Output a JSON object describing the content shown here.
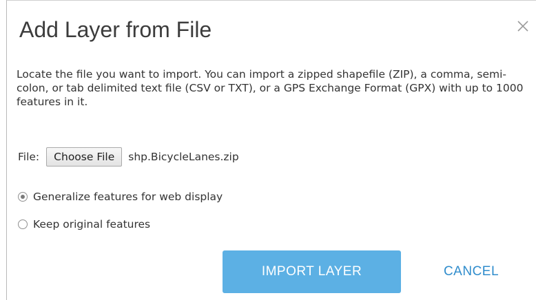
{
  "dialog": {
    "title": "Add Layer from File",
    "close_icon": "close-icon",
    "description": "Locate the file you want to import. You can import a zipped shapefile (ZIP), a comma, semi-colon, or tab delimited text file (CSV or TXT), or a GPS Exchange Format (GPX) with up to 1000 features in it."
  },
  "file": {
    "label": "File:",
    "choose_button": "Choose File",
    "selected_file": "shp.BicycleLanes.zip"
  },
  "options": [
    {
      "label": "Generalize features for web display",
      "selected": true
    },
    {
      "label": "Keep original features",
      "selected": false
    }
  ],
  "actions": {
    "import_label": "IMPORT LAYER",
    "cancel_label": "CANCEL"
  },
  "colors": {
    "primary_button": "#5cb0e4",
    "link": "#2f8ccc"
  }
}
